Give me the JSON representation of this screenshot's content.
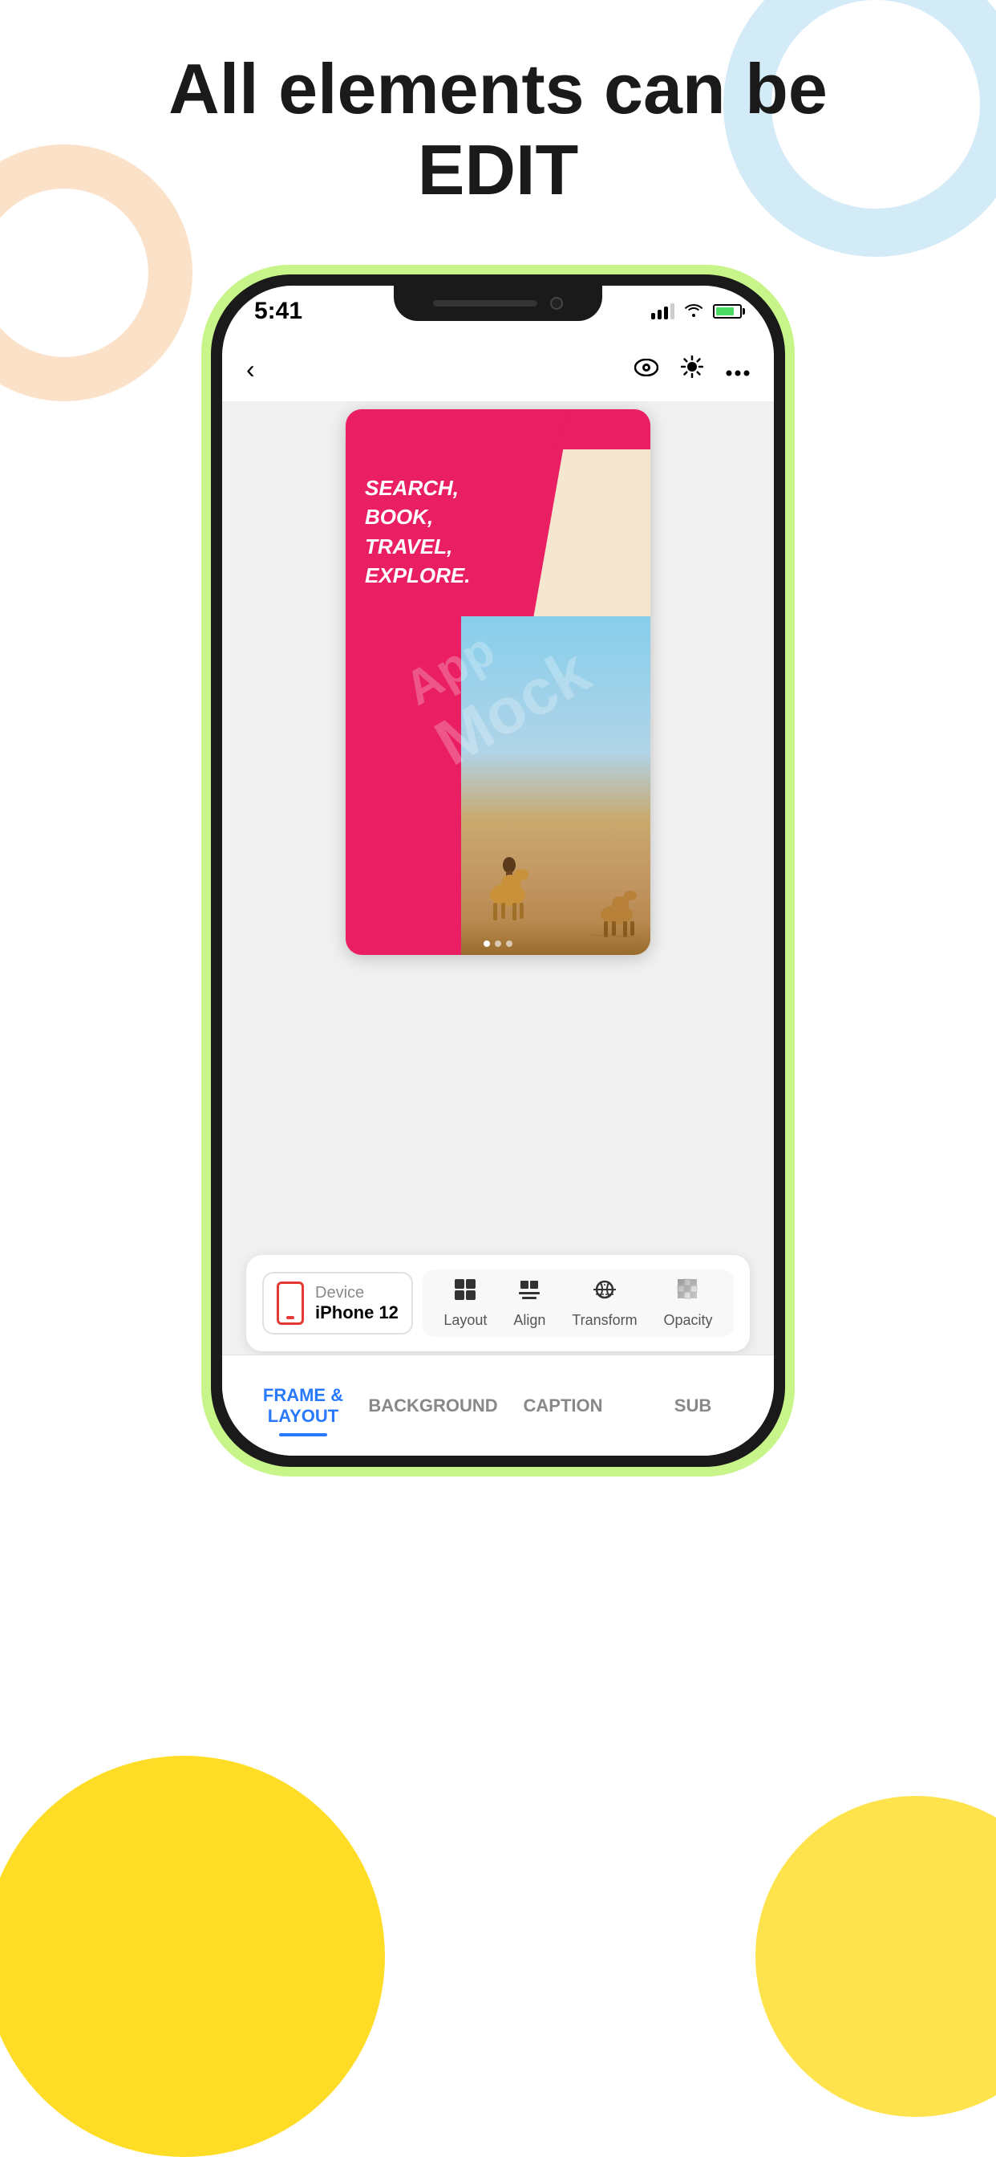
{
  "page": {
    "title_line1": "All elements can be",
    "title_line2": "EDIT"
  },
  "status_bar": {
    "time": "5:41"
  },
  "nav": {
    "back_label": "‹",
    "eye_icon": "eye",
    "sun_icon": "sun",
    "more_icon": "more"
  },
  "design_preview": {
    "travel_text_line1": "SEARCH,",
    "travel_text_line2": "BOOK,",
    "travel_text_line3": "TRAVEL,",
    "travel_text_line4": "EXPLORE.",
    "watermark": "App Mock"
  },
  "device_selector": {
    "label": "Device",
    "name": "iPhone 12"
  },
  "tools": [
    {
      "icon": "layout",
      "label": "Layout"
    },
    {
      "icon": "align",
      "label": "Align"
    },
    {
      "icon": "transform",
      "label": "Transform"
    },
    {
      "icon": "opacity",
      "label": "Opacity"
    }
  ],
  "bottom_tabs": [
    {
      "id": "frame-layout",
      "label": "FRAME & LAYOUT",
      "active": true
    },
    {
      "id": "background",
      "label": "BACKGROUND",
      "active": false
    },
    {
      "id": "caption",
      "label": "CAPTION",
      "active": false
    },
    {
      "id": "sub",
      "label": "SUB",
      "active": false
    }
  ],
  "colors": {
    "accent_blue": "#2979ff",
    "phone_glow": "#c8f58a",
    "pink_design": "#e91e63",
    "yellow_blob": "#ffd700",
    "bg_blue_ring": "#a8d8f0",
    "bg_peach_ring": "#f7c89b"
  }
}
